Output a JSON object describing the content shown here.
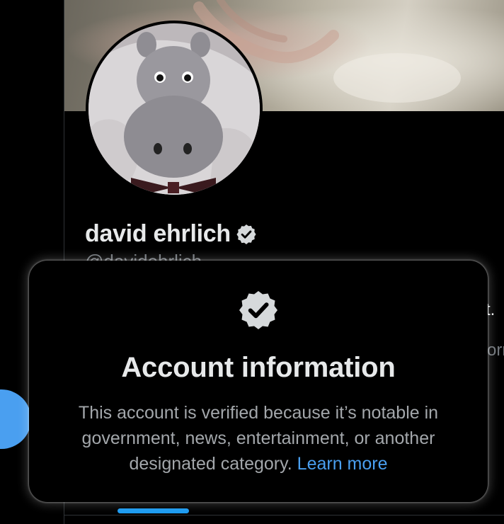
{
  "profile": {
    "display_name": "david ehrlich",
    "handle": "@davidehrlich",
    "verified_badge_icon": "verified-badge-icon"
  },
  "background_text": {
    "line1_fragment": "t.",
    "line2_fragment": "orn"
  },
  "popover": {
    "icon": "verified-badge-icon",
    "title": "Account information",
    "body": "This account is verified because it’s notable in government, news, entertainment, or another designated category.",
    "link_label": "Learn more"
  },
  "colors": {
    "accent": "#1d9bf0",
    "link": "#4a9ff0",
    "background": "#000000",
    "text_primary": "#e7e9ea",
    "text_secondary": "#a3a7ab"
  }
}
